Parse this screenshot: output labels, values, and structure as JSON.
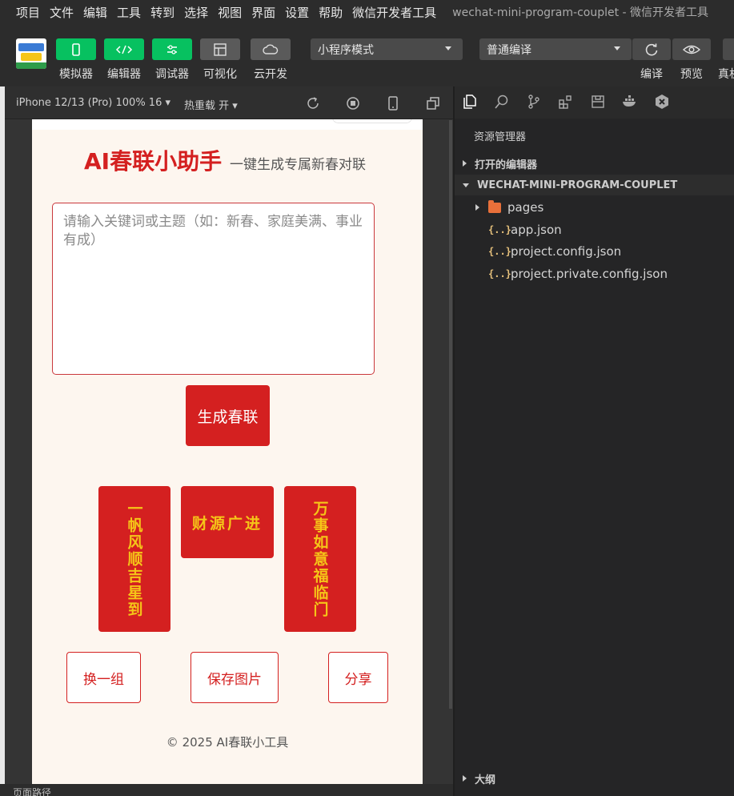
{
  "menu": {
    "items": [
      "项目",
      "文件",
      "编辑",
      "工具",
      "转到",
      "选择",
      "视图",
      "界面",
      "设置",
      "帮助",
      "微信开发者工具"
    ],
    "window_title": "wechat-mini-program-couplet - 微信开发者工具"
  },
  "toolbar": {
    "simulator": "模拟器",
    "editor": "编辑器",
    "debugger": "调试器",
    "visual": "可视化",
    "cloud": "云开发",
    "mode_select": "小程序模式",
    "compile_select": "普通编译",
    "compile": "编译",
    "preview": "预览",
    "real_device": "真机"
  },
  "simulator_bar": {
    "device": "iPhone 12/13 (Pro) 100% 16 ▾",
    "hot_reload": "热重载 开 ▾"
  },
  "app": {
    "title": "AI春联小助手",
    "subtitle": "一键生成专属新春对联",
    "input_placeholder": "请输入关键词或主题（如：新春、家庭美满、事业有成）",
    "generate_button": "生成春联",
    "couplet": {
      "left": "一帆风顺吉星到",
      "horizontal": "财源广进",
      "right": "万事如意福临门"
    },
    "change_button": "换一组",
    "save_button": "保存图片",
    "share_button": "分享",
    "footer": "© 2025 AI春联小工具"
  },
  "explorer": {
    "title": "资源管理器",
    "open_editors": "打开的编辑器",
    "project": "WECHAT-MINI-PROGRAM-COUPLET",
    "files": [
      "pages",
      "app.json",
      "project.config.json",
      "project.private.config.json"
    ],
    "outline": "大纲"
  },
  "statusbar": {
    "page_path": "页面路径"
  },
  "colors": {
    "accent_red": "#d42020",
    "gold": "#f5c518",
    "wechat_green": "#07c160"
  }
}
